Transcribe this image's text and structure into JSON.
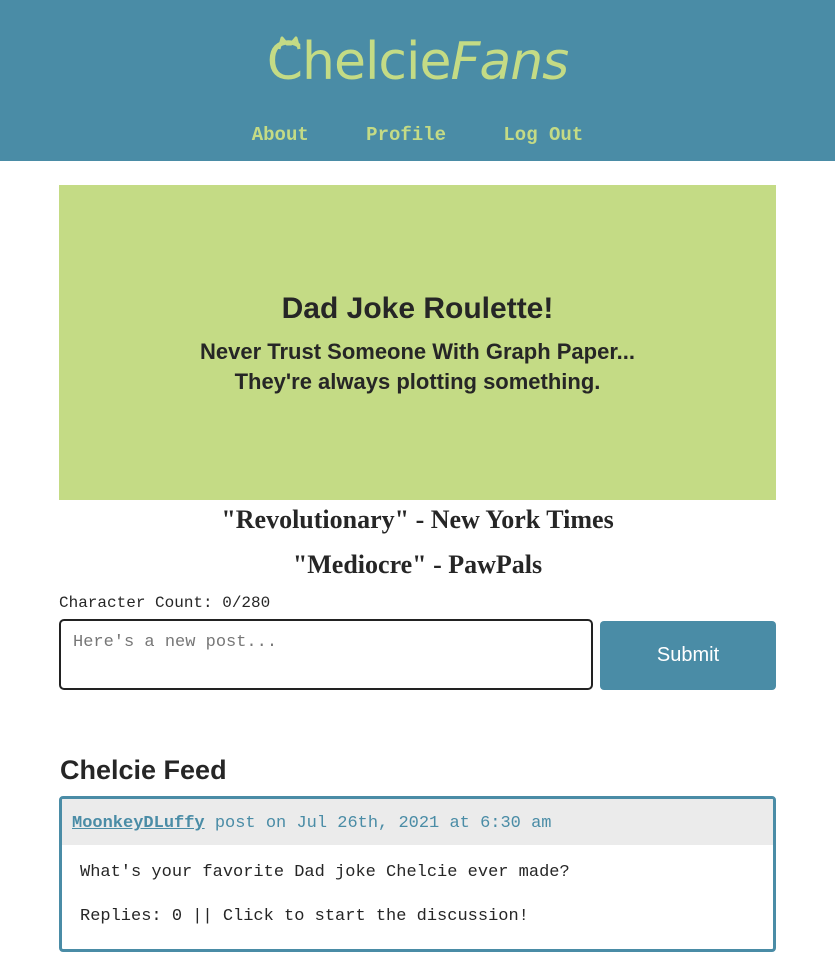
{
  "header": {
    "logo_main": "Chelcie",
    "logo_accent": "Fans",
    "nav": [
      {
        "label": "About"
      },
      {
        "label": "Profile"
      },
      {
        "label": "Log Out"
      }
    ]
  },
  "hero": {
    "title": "Dad Joke Roulette!",
    "joke_line1": "Never Trust Someone With Graph Paper...",
    "joke_line2": "They're always plotting something."
  },
  "quotes": [
    "\"Revolutionary\" - New York Times",
    "\"Mediocre\" - PawPals"
  ],
  "composer": {
    "char_count": "Character Count: 0/280",
    "placeholder": "Here's a new post...",
    "submit_label": "Submit"
  },
  "feed": {
    "title": "Chelcie Feed",
    "posts": [
      {
        "author": "MoonkeyDLuffy",
        "meta": " post on Jul 26th, 2021 at 6:30 am",
        "body": "What's your favorite Dad joke Chelcie ever made?",
        "replies": "Replies: 0 || Click to start the discussion!"
      }
    ]
  },
  "colors": {
    "header_bg": "#4a8ca6",
    "accent_green": "#c4db85",
    "text_dark": "#262626"
  }
}
